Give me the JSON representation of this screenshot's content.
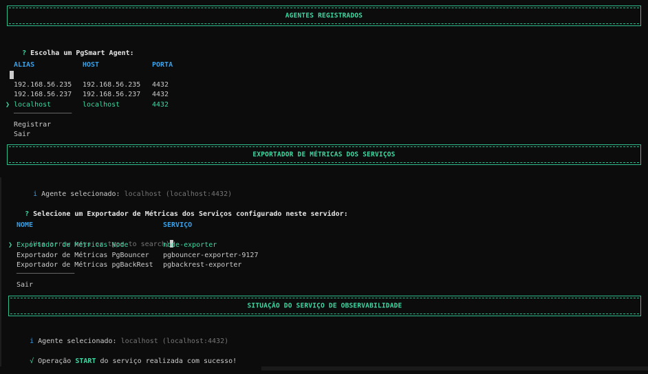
{
  "section1": {
    "banner": "AGENTES REGISTRADOS",
    "prompt_mark": "?",
    "prompt": "Escolha um PgSmart Agent:",
    "headers": [
      "ALIAS",
      "HOST",
      "PORTA"
    ],
    "rows": [
      {
        "alias": "192.168.56.235",
        "host": "192.168.56.235",
        "port": "4432"
      },
      {
        "alias": "192.168.56.237",
        "host": "192.168.56.237",
        "port": "4432"
      },
      {
        "alias": "localhost",
        "host": "localhost",
        "port": "4432"
      }
    ],
    "pointer": "❯",
    "separator": "──────────────",
    "actions": [
      "Registrar",
      "Sair"
    ]
  },
  "section2": {
    "banner": "EXPORTADOR DE MÉTRICAS DOS SERVIÇOS",
    "info_mark": "i",
    "info_label": "Agente selecionado:",
    "info_value": "localhost (localhost:4432)",
    "prompt_mark": "?",
    "prompt": "Selecione um Exportador de Métricas dos Serviços configurado neste servidor:",
    "headers": [
      "NOME",
      "SERVIÇO"
    ],
    "hint": "(Use arrow keys or type to search)",
    "pointer": "❯",
    "rows": [
      {
        "name": "Exportador de Métricas Node",
        "service": "node-exporter"
      },
      {
        "name": "Exportador de Métricas PgBouncer",
        "service": "pgbouncer-exporter-9127"
      },
      {
        "name": "Exportador de Métricas pgBackRest",
        "service": "pgbackrest-exporter"
      }
    ],
    "separator": "──────────────",
    "actions": [
      "Sair"
    ]
  },
  "section3": {
    "banner": "SITUAÇÃO DO SERVIÇO DE OBSERVABILIDADE",
    "info_mark": "i",
    "info_label": "Agente selecionado:",
    "info_value": "localhost (localhost:4432)",
    "ok_mark": "√",
    "ok_prefix": "Operação",
    "ok_keyword": "START",
    "ok_suffix": "do serviço realizada com sucesso!"
  }
}
